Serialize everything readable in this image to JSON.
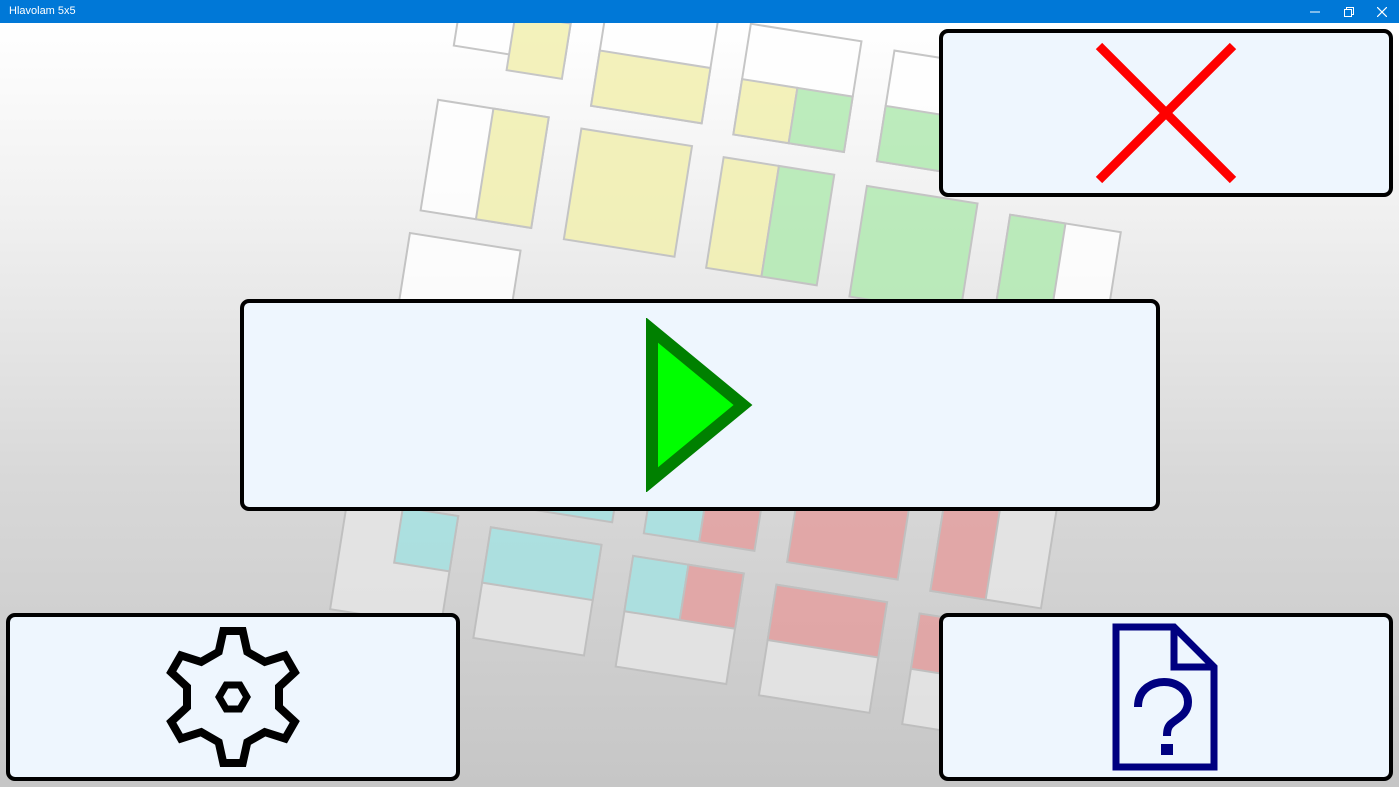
{
  "window": {
    "title": "Hlavolam 5x5",
    "controls": [
      "minimize-icon",
      "restore-icon",
      "close-icon"
    ]
  },
  "buttons": {
    "play": {
      "icon": "play-icon"
    },
    "exit": {
      "icon": "red-x-icon"
    },
    "settings": {
      "icon": "gear-icon"
    },
    "help": {
      "icon": "help-document-icon"
    }
  },
  "colors": {
    "titlebar": "#0078d7",
    "panel_background": "#eef6fe",
    "panel_border": "#000000",
    "play_fill": "#00ff00",
    "play_stroke": "#008000",
    "exit_x": "#ff0000",
    "help_icon": "#000080",
    "tile_yellow": "#f0f0a8",
    "tile_green": "#a8e8a8",
    "tile_cyan": "#9adcdc",
    "tile_red": "#e09898"
  }
}
